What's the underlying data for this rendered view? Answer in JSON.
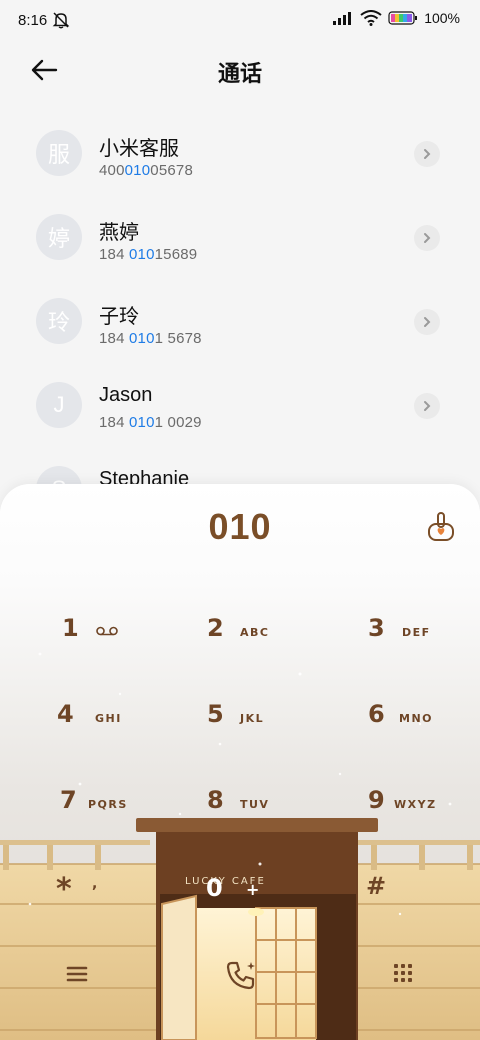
{
  "status": {
    "time": "8:16",
    "battery": "100%"
  },
  "header": {
    "title": "通话"
  },
  "contacts": [
    {
      "avatar": "服",
      "name": "小米客服",
      "num_pre": "400",
      "num_hl": "010",
      "num_post": "05678"
    },
    {
      "avatar": "婷",
      "name": "燕婷",
      "num_pre": "184 ",
      "num_hl": "010",
      "num_post": "15689"
    },
    {
      "avatar": "玲",
      "name": "子玲",
      "num_pre": "184 ",
      "num_hl": "010",
      "num_post": "1 5678"
    },
    {
      "avatar": "J",
      "name": "Jason",
      "num_pre": "184 ",
      "num_hl": "010",
      "num_post": "1 0029"
    },
    {
      "avatar": "S",
      "name": "Stephanie",
      "num_pre": "",
      "num_hl": "",
      "num_post": ""
    }
  ],
  "dialer": {
    "display": "010",
    "keys": [
      {
        "digit": "1",
        "letters": ""
      },
      {
        "digit": "2",
        "letters": "ABC"
      },
      {
        "digit": "3",
        "letters": "DEF"
      },
      {
        "digit": "4",
        "letters": "GHI"
      },
      {
        "digit": "5",
        "letters": "JKL"
      },
      {
        "digit": "6",
        "letters": "MNO"
      },
      {
        "digit": "7",
        "letters": "PQRS"
      },
      {
        "digit": "8",
        "letters": "TUV"
      },
      {
        "digit": "9",
        "letters": "WXYZ"
      },
      {
        "digit": "*",
        "letters": ","
      },
      {
        "digit": "0",
        "letters": "+"
      },
      {
        "digit": "#",
        "letters": ""
      }
    ],
    "shop_sign": "LUCKY CAFE"
  },
  "colors": {
    "accent": "#1f7ce6",
    "dial_brown": "#7a4e28",
    "key_brown": "#6e4526"
  },
  "icons": {
    "voicemail": "voicemail-icon",
    "menu": "menu-icon",
    "call": "call-icon",
    "keypad": "keypad-icon",
    "hand": "hand-icon"
  }
}
